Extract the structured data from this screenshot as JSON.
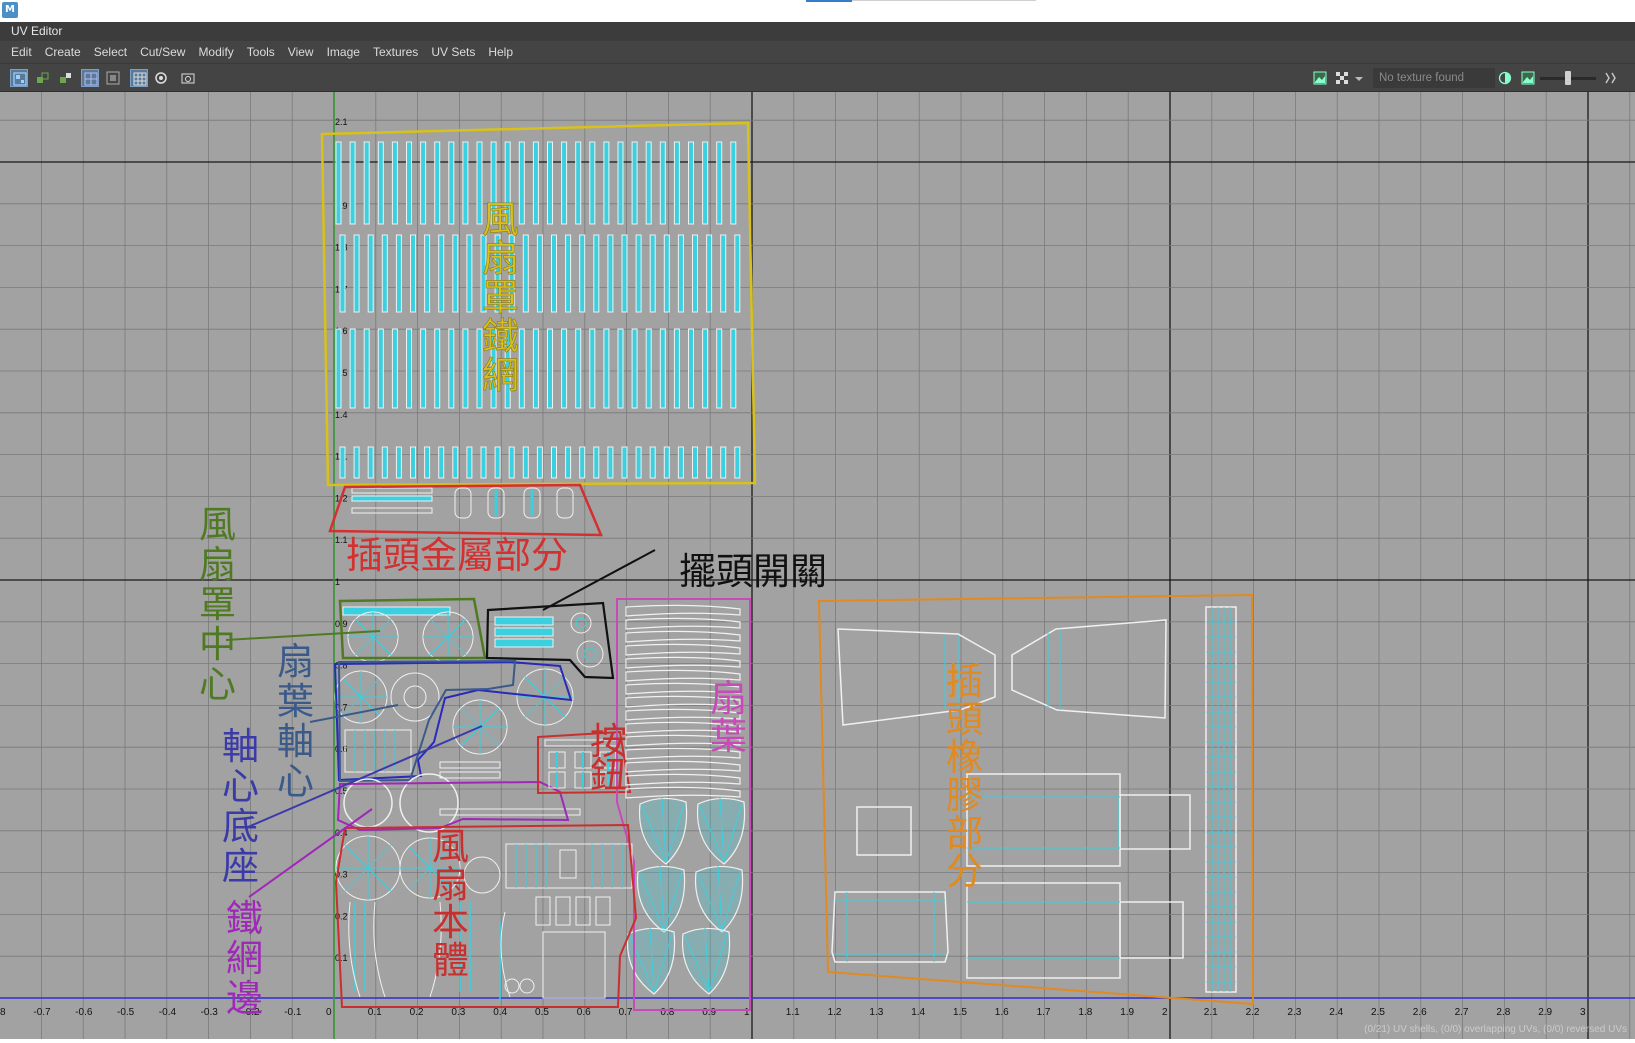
{
  "window": {
    "title": "UV Editor"
  },
  "menu": [
    "Edit",
    "Create",
    "Select",
    "Cut/Sew",
    "Modify",
    "Tools",
    "View",
    "Image",
    "Textures",
    "UV Sets",
    "Help"
  ],
  "toolbar": {
    "texture_status": "No texture found"
  },
  "axis": {
    "x_ticks": [
      "0.8",
      "-0.7",
      "-0.6",
      "-0.5",
      "-0.4",
      "-0.3",
      "-0.2",
      "-0.1",
      "0",
      "0.1",
      "0.2",
      "0.3",
      "0.4",
      "0.5",
      "0.6",
      "0.7",
      "0.8",
      "0.9",
      "1",
      "1.1",
      "1.2",
      "1.3",
      "1.4",
      "1.5",
      "1.6",
      "1.7",
      "1.8",
      "1.9",
      "2",
      "2.1",
      "2.2",
      "2.3",
      "2.4",
      "2.5",
      "2.6",
      "2.7",
      "2.8",
      "2.9",
      "3"
    ],
    "y_ticks": [
      "0.1",
      "0.2",
      "0.3",
      "0.4",
      "0.5",
      "0.6",
      "0.7",
      "0.8",
      "0.9",
      "1",
      "1.1",
      "1.2",
      "1.1",
      "1.4",
      "1.5",
      "1.6",
      "1.7",
      "1.8",
      "1.9",
      "2",
      "2.1"
    ]
  },
  "labels": {
    "mesh_cover": "風扇罩鐵網",
    "plug_metal": "插頭金屬部分",
    "swing_switch": "擺頭開關",
    "cover_center": "風扇罩中心",
    "blade_hub": "扇葉軸心",
    "hub_base": "軸心底座",
    "mesh_edge": "鐵網邊",
    "button": "按鈕",
    "blades": "扇葉",
    "fan_body": "風扇本體",
    "plug_rubber": "插頭橡膠部分"
  },
  "colors": {
    "mesh_cover": "#d8c21a",
    "plug_metal": "#d43030",
    "swing_switch": "#111111",
    "cover_center": "#4f7a22",
    "blade_hub": "#3a5a8a",
    "hub_base": "#3a3aa8",
    "mesh_edge": "#a028b8",
    "button": "#c83030",
    "blades": "#c84ab8",
    "fan_body": "#c83030",
    "plug_rubber": "#e08a20",
    "uv_wire": "#f0f0f0",
    "uv_fill": "#3ad0e0",
    "grid_bg": "#a2a2a2"
  },
  "status": {
    "text": "(0/21) UV shells, (0/0) overlapping UVs, (0/0) reversed UVs"
  }
}
